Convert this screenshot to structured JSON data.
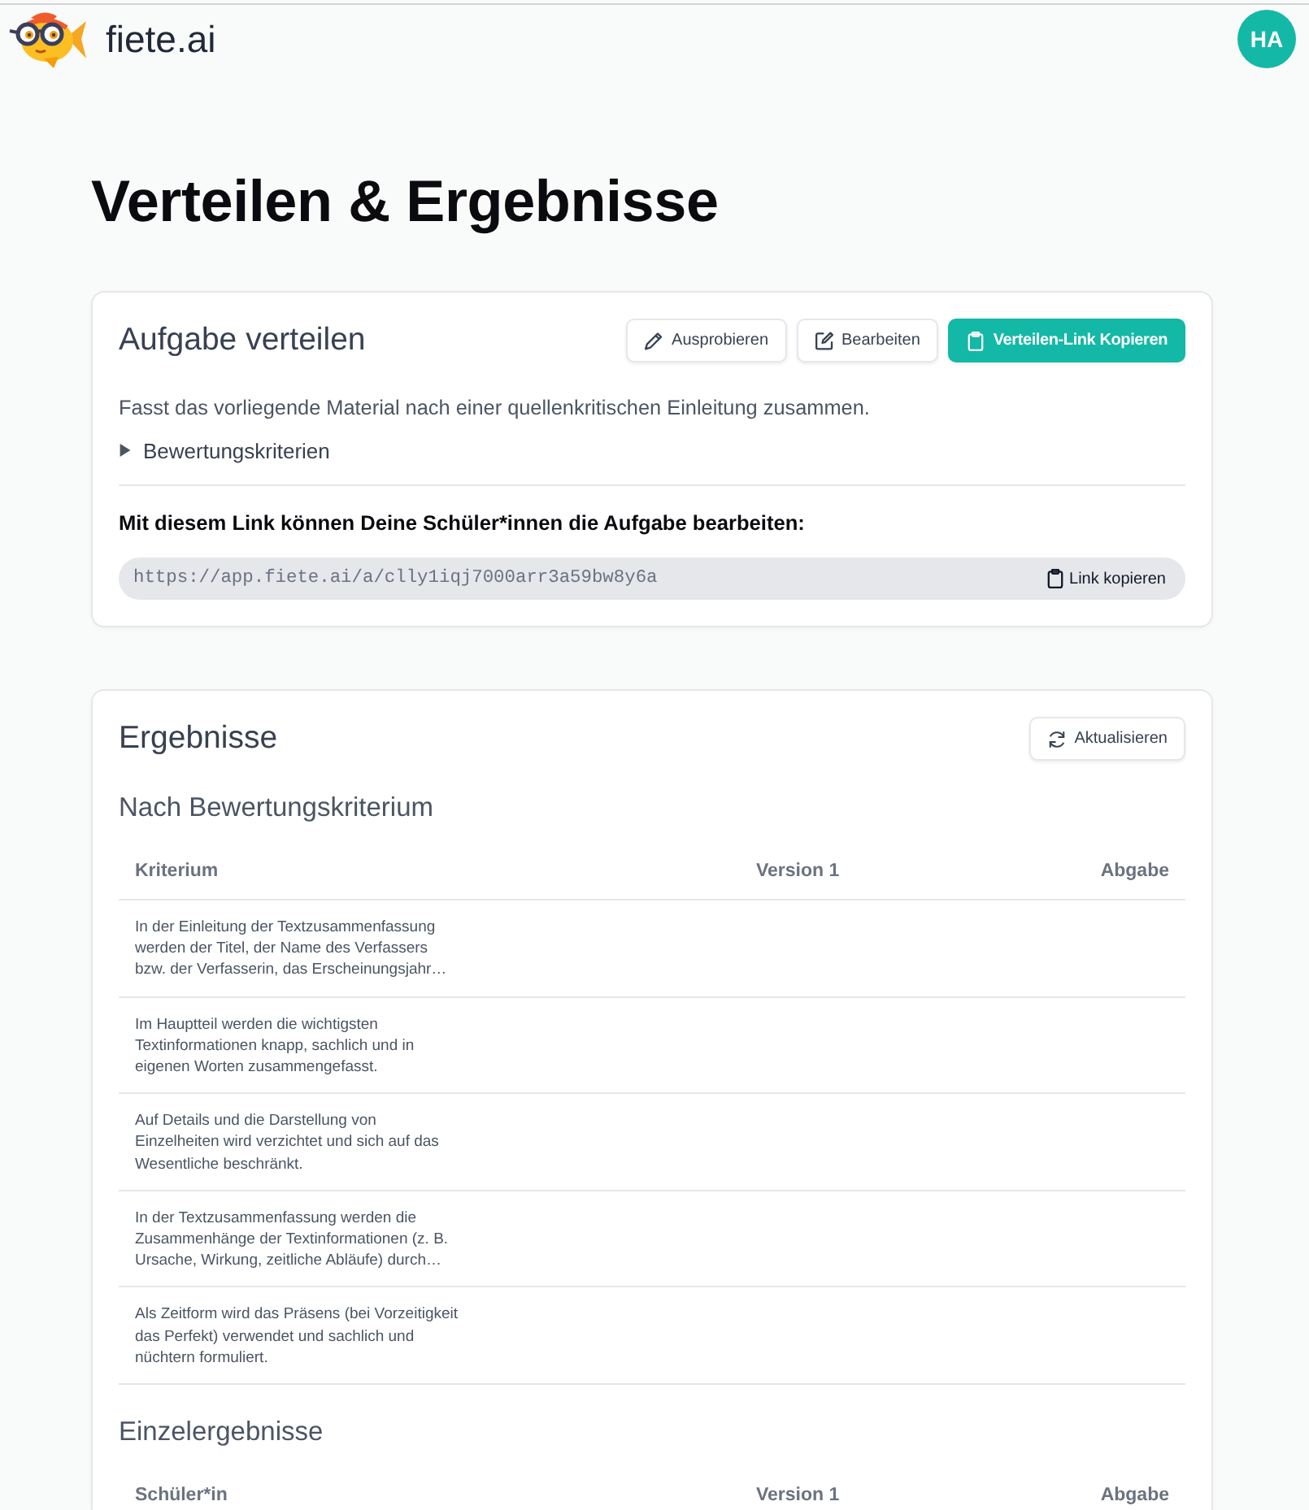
{
  "header": {
    "brand": "fiete.ai",
    "avatar": "HA"
  },
  "page_title": "Verteilen & Ergebnisse",
  "distribute": {
    "title": "Aufgabe verteilen",
    "buttons": [
      {
        "label": "Ausprobieren",
        "kind": "pencil",
        "primary": false
      },
      {
        "label": "Bearbeiten",
        "kind": "edit",
        "primary": false
      },
      {
        "label": "Verteilen-Link Kopieren",
        "kind": "clipboard",
        "primary": true
      }
    ],
    "description": "Fasst das vorliegende Material nach einer quellenkritischen Einleitung zusammen.",
    "criteria_toggle": {
      "label": "Bewertungskriterien",
      "expanded": false
    },
    "link_intro": "Mit diesem Link können Deine Schüler*innen die Aufgabe bearbeiten:",
    "link": {
      "value": "https://app.fiete.ai/a/clly1iqj7000arr3a59bw8y6a",
      "button": "Link kopieren"
    }
  },
  "results": {
    "title": "Ergebnisse",
    "refresh_button": "Aktualisieren",
    "by_criterion": {
      "title": "Nach Bewertungskriterium",
      "columns": [
        "Kriterium",
        "Version 1",
        "Abgabe"
      ],
      "rows": [
        {
          "criterion": "In der Einleitung der Textzusammenfassung werden der Titel, der Name des Verfassers bzw. der Verfasserin, das Erscheinungsjahr…"
        },
        {
          "criterion": "Im Hauptteil werden die wichtigsten Textinformationen knapp, sachlich und in eigenen Worten zusammengefasst."
        },
        {
          "criterion": "Auf Details und die Darstellung von Einzelheiten wird verzichtet und sich auf das Wesentliche beschränkt."
        },
        {
          "criterion": "In der Textzusammenfassung werden die Zusammenhänge der Textinformationen (z. B. Ursache, Wirkung, zeitliche Abläufe) durch…"
        },
        {
          "criterion": "Als Zeitform wird das Präsens (bei Vorzeitigkeit das Perfekt) verwendet und sachlich und nüchtern formuliert."
        }
      ]
    },
    "individual": {
      "title": "Einzelergebnisse",
      "columns": [
        "Schüler*in",
        "Version 1",
        "Abgabe"
      ]
    }
  }
}
